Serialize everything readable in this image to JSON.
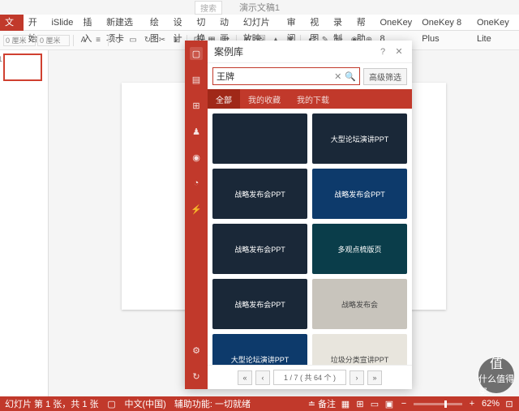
{
  "titlebar": {
    "doc_name": "演示文稿1",
    "search_placeholder": "搜索"
  },
  "menu": {
    "items": [
      "文件",
      "开始",
      "iSlide",
      "插入",
      "新建选项卡",
      "绘图",
      "设计",
      "切换",
      "动画",
      "幻灯片放映",
      "审阅",
      "视图",
      "录制",
      "帮助",
      "OneKey 8",
      "OneKey 8 Plus",
      "OneKey Lite"
    ],
    "active_index": 0
  },
  "toolbar": {
    "size1": "0 厘米",
    "size2": "0 厘米"
  },
  "panel": {
    "title": "案例库",
    "search_value": "王牌",
    "advanced_label": "高级筛选",
    "tabs": [
      "全部",
      "我的收藏",
      "我的下载"
    ],
    "active_tab": 0,
    "cards": [
      {
        "label": "",
        "cls": ""
      },
      {
        "label": "大型论坛演讲PPT",
        "cls": ""
      },
      {
        "label": "战略发布会PPT",
        "cls": ""
      },
      {
        "label": "战略发布会PPT",
        "cls": "blue"
      },
      {
        "label": "战略发布会PPT",
        "cls": ""
      },
      {
        "label": "多观点梳版页",
        "cls": "teal"
      },
      {
        "label": "战略发布会PPT",
        "cls": ""
      },
      {
        "label": "战略发布会",
        "cls": "gray"
      },
      {
        "label": "大型论坛演讲PPT",
        "cls": "blue"
      },
      {
        "label": "垃圾分类宣讲PPT",
        "cls": "light"
      }
    ],
    "pager": {
      "info": "1 / 7 ( 共 64 个 )"
    }
  },
  "statusbar": {
    "slide_info": "幻灯片 第 1 张，共 1 张",
    "lang": "中文(中国)",
    "access": "辅助功能: 一切就绪",
    "notes": "备注",
    "zoom": "62%"
  },
  "watermark": {
    "l1": "值",
    "l2": "什么值得买"
  }
}
